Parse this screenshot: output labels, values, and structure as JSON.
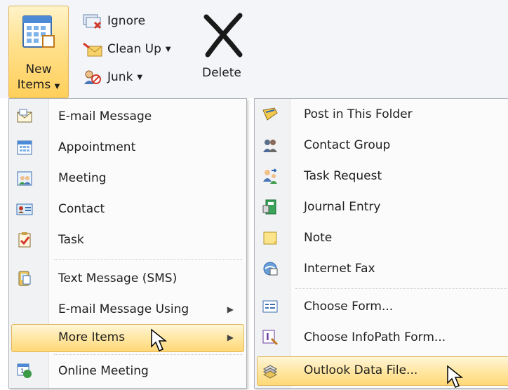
{
  "ribbon": {
    "new_items_line1": "New",
    "new_items_line2": "Items",
    "ignore": "Ignore",
    "clean_up": "Clean Up",
    "junk": "Junk",
    "delete": "Delete"
  },
  "new_items_menu": {
    "items": [
      {
        "label": "E-mail Message",
        "icon": "email-icon"
      },
      {
        "label": "Appointment",
        "icon": "calendar-icon"
      },
      {
        "label": "Meeting",
        "icon": "meeting-icon"
      },
      {
        "label": "Contact",
        "icon": "contact-card-icon"
      },
      {
        "label": "Task",
        "icon": "task-icon"
      },
      {
        "label": "Text Message (SMS)",
        "icon": "sms-icon"
      },
      {
        "label": "E-mail Message Using",
        "icon": ""
      },
      {
        "label": "More Items",
        "icon": ""
      },
      {
        "label": "Online Meeting",
        "icon": "online-meeting-icon"
      }
    ]
  },
  "more_items_menu": {
    "items": [
      {
        "label": "Post in This Folder",
        "icon": "post-icon"
      },
      {
        "label": "Contact Group",
        "icon": "contact-group-icon"
      },
      {
        "label": "Task Request",
        "icon": "task-request-icon"
      },
      {
        "label": "Journal Entry",
        "icon": "journal-icon"
      },
      {
        "label": "Note",
        "icon": "note-icon"
      },
      {
        "label": "Internet Fax",
        "icon": "fax-icon"
      },
      {
        "label": "Choose Form...",
        "icon": "form-icon"
      },
      {
        "label": "Choose InfoPath Form...",
        "icon": "infopath-icon"
      },
      {
        "label": "Outlook Data File...",
        "icon": "data-file-icon"
      }
    ]
  },
  "colors": {
    "highlight": "#ffe7a3",
    "highlight_border": "#e1b65c"
  }
}
